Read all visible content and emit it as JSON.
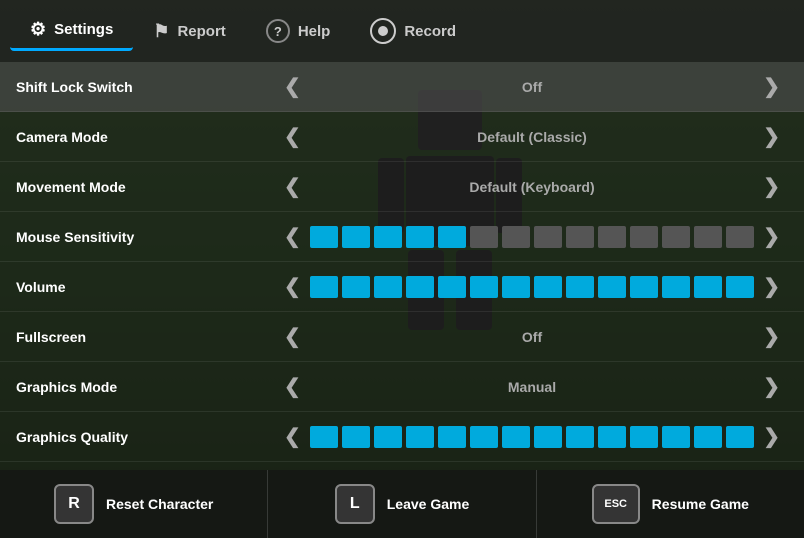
{
  "nav": {
    "items": [
      {
        "id": "settings",
        "label": "Settings",
        "icon": "⚙",
        "active": true
      },
      {
        "id": "report",
        "label": "Report",
        "icon": "⚑",
        "active": false
      },
      {
        "id": "help",
        "label": "Help",
        "icon": "?",
        "active": false
      },
      {
        "id": "record",
        "label": "Record",
        "icon": "◎",
        "active": false
      }
    ]
  },
  "settings": {
    "rows": [
      {
        "id": "shift-lock",
        "label": "Shift Lock Switch",
        "type": "toggle",
        "value": "Off",
        "highlighted": true
      },
      {
        "id": "camera-mode",
        "label": "Camera Mode",
        "type": "toggle",
        "value": "Default (Classic)",
        "highlighted": false
      },
      {
        "id": "movement-mode",
        "label": "Movement Mode",
        "type": "toggle",
        "value": "Default (Keyboard)",
        "highlighted": false
      },
      {
        "id": "mouse-sensitivity",
        "label": "Mouse Sensitivity",
        "type": "slider",
        "value": "",
        "filled": 5,
        "total": 14,
        "highlighted": false
      },
      {
        "id": "volume",
        "label": "Volume",
        "type": "slider",
        "value": "",
        "filled": 14,
        "total": 14,
        "highlighted": false
      },
      {
        "id": "fullscreen",
        "label": "Fullscreen",
        "type": "toggle",
        "value": "Off",
        "highlighted": false
      },
      {
        "id": "graphics-mode",
        "label": "Graphics Mode",
        "type": "toggle",
        "value": "Manual",
        "highlighted": false
      },
      {
        "id": "graphics-quality",
        "label": "Graphics Quality",
        "type": "slider",
        "value": "",
        "filled": 14,
        "total": 14,
        "highlighted": false
      }
    ]
  },
  "actions": [
    {
      "id": "reset",
      "key": "R",
      "label": "Reset Character",
      "key_style": "normal"
    },
    {
      "id": "leave",
      "key": "L",
      "label": "Leave Game",
      "key_style": "normal"
    },
    {
      "id": "resume",
      "key": "ESC",
      "label": "Resume Game",
      "key_style": "esc"
    }
  ],
  "arrows": {
    "left": "❮",
    "right": "❯"
  }
}
